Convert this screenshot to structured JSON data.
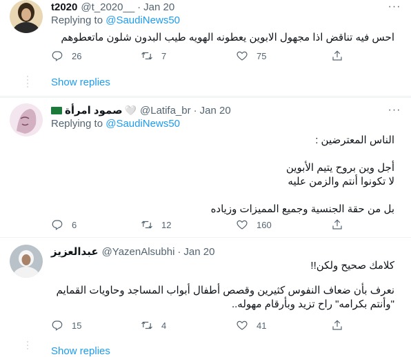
{
  "tweets": [
    {
      "display_name": "t2020",
      "handle": "@t_2020__",
      "date": "Jan 20",
      "replying_label": "Replying to",
      "replying_to": "@SaudiNews50",
      "lines": [
        "احس فيه تناقض اذا مجهول الابوين يعطونه الهويه طيب البدون شلون ماتعطوهم"
      ],
      "replies": "26",
      "retweets": "7",
      "likes": "75",
      "show_replies": "Show replies"
    },
    {
      "display_name": "صمود امرأة",
      "name_emoji": "🤍",
      "handle": "@Latifa_br",
      "date": "Jan 20",
      "replying_label": "Replying to",
      "replying_to": "@SaudiNews50",
      "lines": [
        "الناس المعترضين :",
        "",
        "أجل وين بروح يتيم الأبوين",
        "لا تكونوا أنتم والزمن عليه",
        "",
        "بل من حقة الجنسية وجميع المميزات وزياده"
      ],
      "replies": "6",
      "retweets": "12",
      "likes": "160"
    },
    {
      "display_name": "عبدالعزيز",
      "handle": "@YazenAlsubhi",
      "date": "Jan 20",
      "lines": [
        "كلامك صحيح ولكن!!",
        "",
        "نعرف بأن ضعاف النفوس كثيرين وقصص أطفال أبواب المساجد وحاويات القمايم",
        "\"وأنتم بكرامه\" راح تزيد وبأرقام مهوله.."
      ],
      "replies": "15",
      "retweets": "4",
      "likes": "41",
      "show_replies": "Show replies"
    }
  ],
  "colors": {
    "link": "#1d9bf0",
    "secondary": "#536471",
    "text": "#0f1419"
  }
}
